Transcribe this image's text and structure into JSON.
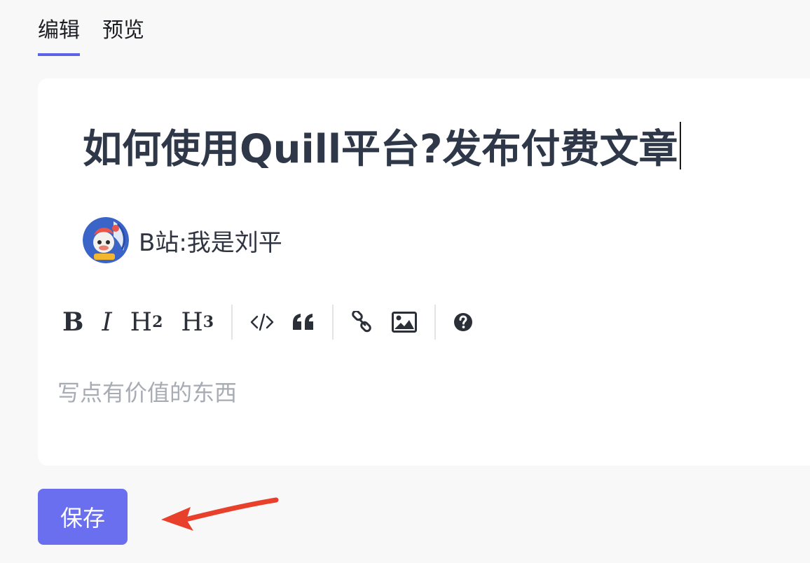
{
  "tabs": [
    {
      "label": "编辑",
      "active": true
    },
    {
      "label": "预览",
      "active": false
    }
  ],
  "editor": {
    "title": "如何使用Quill平台?发布付费文章",
    "author": "B站:我是刘平",
    "body_placeholder": "写点有价值的东西"
  },
  "toolbar": {
    "bold": "B",
    "italic": "I",
    "h2_base": "H",
    "h2_sup": "2",
    "h3_base": "H",
    "h3_sup": "3",
    "icons": [
      "code-icon",
      "quote-icon",
      "link-icon",
      "image-icon",
      "help-icon"
    ]
  },
  "save_label": "保存",
  "colors": {
    "accent": "#5b63e8",
    "button": "#6a6ff0",
    "annotation_arrow": "#e8402a",
    "title_text": "#2f3848"
  }
}
